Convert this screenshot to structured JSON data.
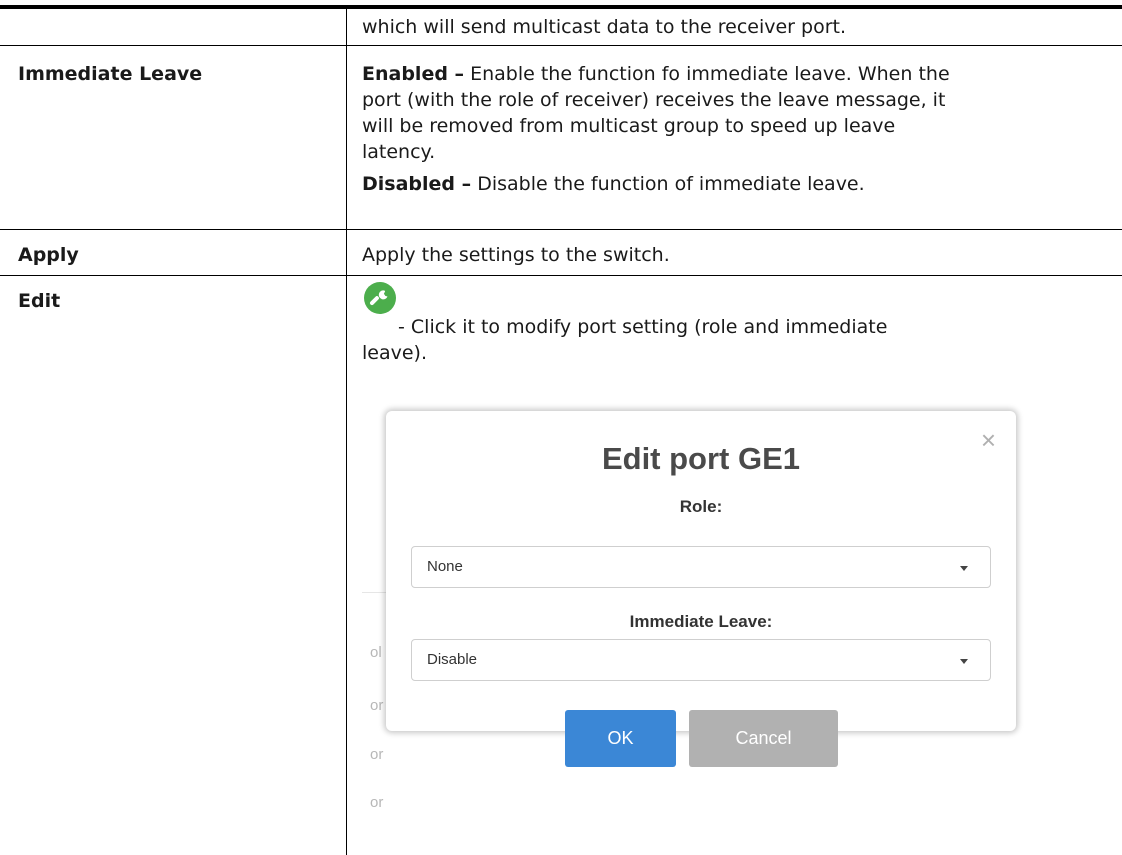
{
  "table": {
    "continued_desc": "which will send multicast data to the receiver port.",
    "rows": [
      {
        "label": "Immediate Leave",
        "lines": [
          "Enable the function fo immediate leave. When the",
          "port (with the role of receiver) receives the leave message, it",
          "will be removed from multicast group to speed up leave",
          "latency."
        ],
        "enabled_term": "Enabled –",
        "disabled_term": "Disabled –",
        "disabled_text": "Disable the function of immediate leave."
      },
      {
        "label": "Apply",
        "desc": "Apply the settings to the switch."
      },
      {
        "label": "Edit",
        "desc_line1": "- Click it to modify port setting (role and immediate",
        "desc_line2": "leave)."
      }
    ]
  },
  "icons": {
    "edit": "wrench-icon",
    "close": "close-icon",
    "caret": "chevron-down-icon"
  },
  "colors": {
    "edit_icon_bg": "#4cae4c",
    "ok_button": "#3b87d6",
    "cancel_button": "#b1b1b1"
  },
  "dialog": {
    "close_glyph": "×",
    "title": "Edit port GE1",
    "role_label": "Role:",
    "role_value": "None",
    "leave_label": "Immediate Leave:",
    "leave_value": "Disable",
    "ok_label": "OK",
    "cancel_label": "Cancel"
  },
  "background_stubs": [
    "ol",
    "or",
    "or",
    "or"
  ]
}
